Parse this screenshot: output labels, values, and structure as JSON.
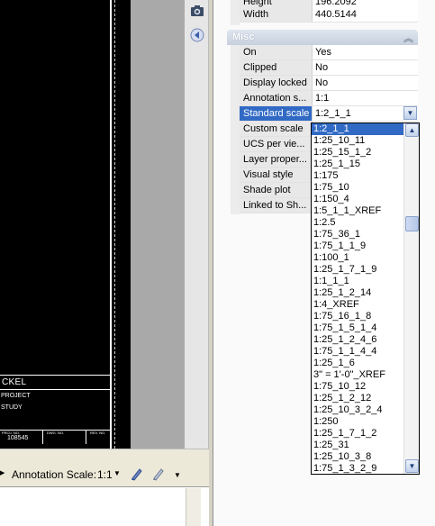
{
  "drawing": {
    "title_block": {
      "name": "CKEL",
      "line1": "PROJECT",
      "line2": "STUDY",
      "number": "108545",
      "label_a": "PROJ. NO.",
      "label_b": "DWG. NO.",
      "label_c": "REV. NO."
    }
  },
  "status_bar": {
    "annotation_label": "Annotation Scale:",
    "annotation_value": "1:1"
  },
  "properties": {
    "geometry": [
      {
        "label": "Height",
        "value": "196.2092"
      },
      {
        "label": "Width",
        "value": "440.5144"
      }
    ],
    "misc_title": "Misc",
    "misc_rows": [
      {
        "label": "On",
        "value": "Yes"
      },
      {
        "label": "Clipped",
        "value": "No"
      },
      {
        "label": "Display locked",
        "value": "No"
      },
      {
        "label": "Annotation s...",
        "value": "1:1"
      },
      {
        "label": "Standard scale",
        "value": "1:2_1_1"
      },
      {
        "label": "Custom scale",
        "value": ""
      },
      {
        "label": "UCS per vie...",
        "value": ""
      },
      {
        "label": "Layer proper...",
        "value": ""
      },
      {
        "label": "Visual style",
        "value": ""
      },
      {
        "label": "Shade plot",
        "value": ""
      },
      {
        "label": "Linked to Sh...",
        "value": ""
      }
    ]
  },
  "dropdown": {
    "selected": "1:2_1_1",
    "options": [
      "1:2_1_1",
      "1:25_10_11",
      "1:25_15_1_2",
      "1:25_1_15",
      "1:175",
      "1:75_10",
      "1:150_4",
      "1:5_1_1_XREF",
      "1:2.5",
      "1:75_36_1",
      "1:75_1_1_9",
      "1:100_1",
      "1:25_1_7_1_9",
      "1:1_1_1",
      "1:25_1_2_14",
      "1:4_XREF",
      "1:75_16_1_8",
      "1:75_1_5_1_4",
      "1:25_1_2_4_6",
      "1:75_1_1_4_4",
      "1:25_1_6",
      "3\" = 1'-0\"_XREF",
      "1:75_10_12",
      "1:25_1_2_12",
      "1:25_10_3_2_4",
      "1:250",
      "1:25_1_7_1_2",
      "1:25_31",
      "1:25_10_3_8",
      "1:75_1_3_2_9"
    ]
  }
}
